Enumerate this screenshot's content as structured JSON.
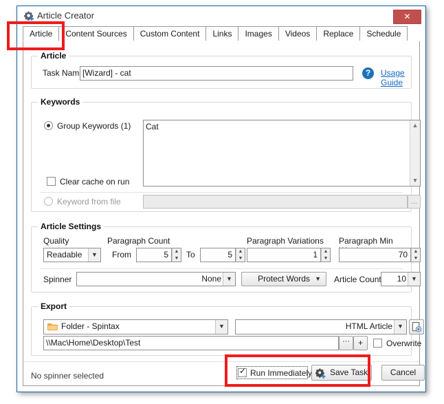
{
  "window": {
    "title": "Article Creator",
    "icon": "gear-plus-icon",
    "close_label": "✕",
    "border_color": "#1a6ba8"
  },
  "tabs": [
    {
      "label": "Article",
      "active": true
    },
    {
      "label": "Content Sources",
      "active": false
    },
    {
      "label": "Custom Content",
      "active": false
    },
    {
      "label": "Links",
      "active": false
    },
    {
      "label": "Images",
      "active": false
    },
    {
      "label": "Videos",
      "active": false
    },
    {
      "label": "Replace",
      "active": false
    },
    {
      "label": "Schedule",
      "active": false
    }
  ],
  "article": {
    "group_title": "Article",
    "task_name_label": "Task Name",
    "task_name_value": "[Wizard] - cat",
    "task_name_placeholder": "",
    "help_icon": "?",
    "usage_guide_link": "Usage Guide"
  },
  "keywords": {
    "group_title": "Keywords",
    "group_keywords_label": "Group Keywords (1)",
    "group_keywords_selected": true,
    "keywords_text": "Cat",
    "clear_cache_label": "Clear cache on run",
    "clear_cache_checked": false,
    "keyword_from_file_label": "Keyword from file",
    "keyword_from_file_selected": false,
    "keyword_file_value": "",
    "browse_label": "..."
  },
  "article_settings": {
    "group_title": "Article Settings",
    "quality_label": "Quality",
    "quality_value": "Readable",
    "paragraph_count_label": "Paragraph Count",
    "from_label": "From",
    "from_value": "5",
    "to_label": "To",
    "to_value": "5",
    "paragraph_variations_label": "Paragraph Variations",
    "paragraph_variations_value": "1",
    "paragraph_min_words_label": "Paragraph Min Words",
    "paragraph_min_words_value": "70",
    "spinner_label": "Spinner",
    "spinner_value": "None",
    "protect_words_label": "Protect Words",
    "article_count_label": "Article Count",
    "article_count_value": "10"
  },
  "export": {
    "group_title": "Export",
    "format_value": "Folder - Spintax",
    "type_value": "HTML Article",
    "settings_icon": "page-gear-icon",
    "path_value": "\\\\Mac\\Home\\Desktop\\Test",
    "browse_label": "···",
    "add_label": "+",
    "overwrite_label": "Overwrite",
    "overwrite_checked": false
  },
  "footer": {
    "status_text": "No spinner selected",
    "run_immediately_label": "Run Immediately",
    "run_immediately_checked": true,
    "save_task_label": "Save Task",
    "save_task_icon": "gear-plus-icon",
    "cancel_label": "Cancel"
  },
  "annotations": {
    "highlight_color": "#ee1c1c",
    "boxes": [
      "article-tab-highlight",
      "save-task-highlight"
    ]
  }
}
